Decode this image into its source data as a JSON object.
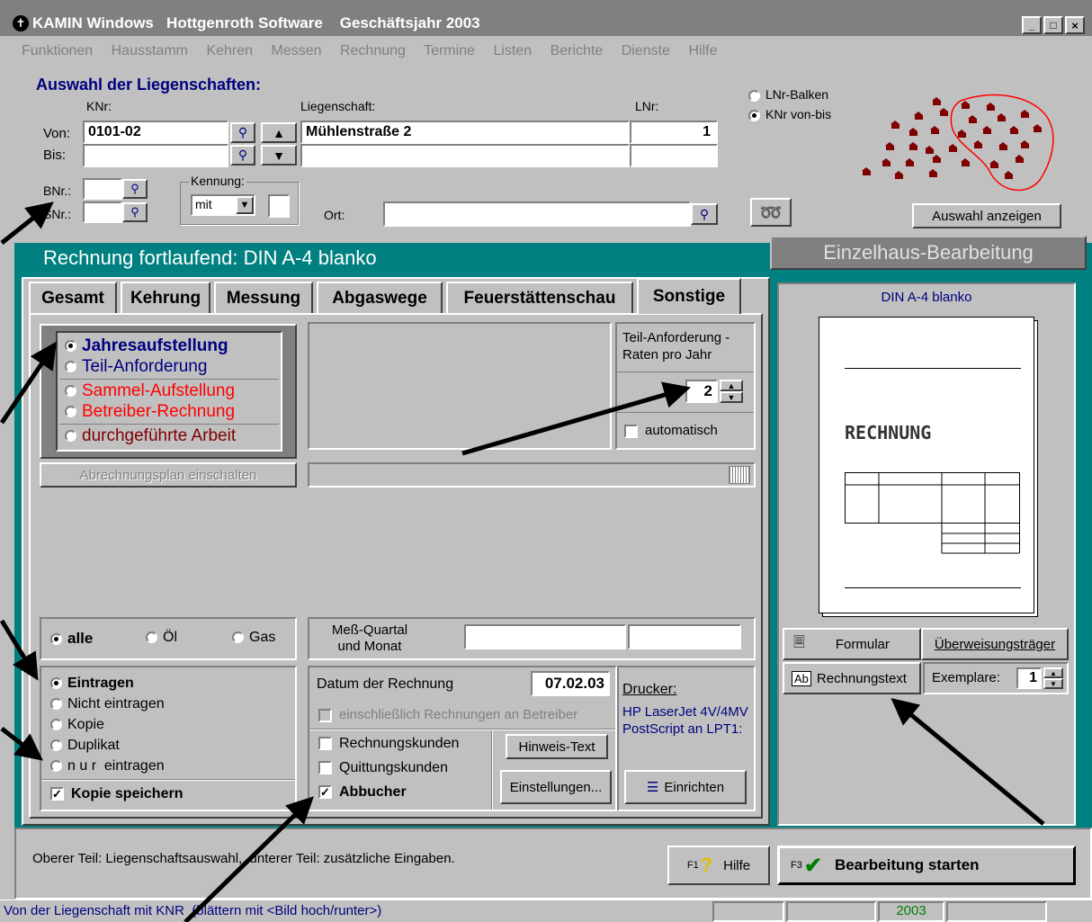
{
  "window": {
    "title": "KAMIN Windows   Hottgenroth Software    Geschäftsjahr 2003",
    "controls": [
      "_",
      "□",
      "×"
    ]
  },
  "menu": [
    "Funktionen",
    "Hausstamm",
    "Kehren",
    "Messen",
    "Rechnung",
    "Termine",
    "Listen",
    "Berichte",
    "Dienste",
    "Hilfe"
  ],
  "selection": {
    "heading": "Auswahl der Liegenschaften:",
    "col_knr": "KNr:",
    "col_liegenschaft": "Liegenschaft:",
    "col_lnr": "LNr:",
    "von_label": "Von:",
    "bis_label": "Bis:",
    "von_knr": "0101-02",
    "von_liegenschaft": "Mühlenstraße 2",
    "von_lnr": "1",
    "bis_knr": "",
    "bnr_label": "BNr.:",
    "snr_label": "SNr.:",
    "kennung_label": "Kennung:",
    "kennung_value": "mit",
    "ort_label": "Ort:",
    "ort_value": "",
    "radio_lnr_balken": "LNr-Balken",
    "radio_knr_vonbis": "KNr von-bis",
    "auswahl_button": "Auswahl anzeigen"
  },
  "panel": {
    "header": "Rechnung fortlaufend: DIN A-4 blanko",
    "right_header": "Einzelhaus-Bearbeitung",
    "tabs": [
      "Gesamt",
      "Kehrung",
      "Messung",
      "Abgaswege",
      "Feuerstättenschau",
      "Sonstige"
    ]
  },
  "invoice_type": {
    "options": [
      "Jahresaufstellung",
      "Teil-Anforderung",
      "Sammel-Aufstellung",
      "Betreiber-Rechnung",
      "durchgeführte Arbeit"
    ],
    "selected": "Jahresaufstellung",
    "plan_button": "Abrechnungsplan einschalten"
  },
  "teil": {
    "label": "Teil-Anforderung - Raten pro Jahr",
    "rates": "2",
    "auto_label": "automatisch"
  },
  "fuel": {
    "options": [
      "alle",
      "Öl",
      "Gas"
    ],
    "selected": "alle"
  },
  "mess": {
    "label": "Meß-Quartal und Monat"
  },
  "entry": {
    "options": [
      "Eintragen",
      "Nicht eintragen",
      "Kopie",
      "Duplikat",
      "n u r  eintragen"
    ],
    "selected": "Eintragen",
    "save_copy": "Kopie speichern"
  },
  "datum": {
    "label": "Datum der Rechnung",
    "value": "07.02.03",
    "incl_label": "einschließlich Rechnungen an Betreiber",
    "rechnungskunden": "Rechnungskunden",
    "quittungskunden": "Quittungskunden",
    "abbucher": "Abbucher",
    "hinweis_button": "Hinweis-Text",
    "einstellungen_button": "Einstellungen..."
  },
  "drucker": {
    "label": "Drucker:",
    "name": "HP LaserJet 4V/4MV PostScript an LPT1:",
    "einrichten_button": "Einrichten"
  },
  "preview": {
    "title": "DIN A-4 blanko",
    "doc_title": "RECHNUNG",
    "formular_button": "Formular",
    "ueberweisung_button": "Überweisungsträger",
    "rechnungstext_button": "Rechnungstext",
    "exemplare_label": "Exemplare:",
    "exemplare_value": "1"
  },
  "bottom": {
    "hint": "Oberer Teil: Liegenschaftsauswahl,  unterer Teil: zusätzliche Eingaben.",
    "help_key": "F1",
    "help_label": "Hilfe",
    "start_key": "F3",
    "start_label": "Bearbeitung starten"
  },
  "status": {
    "text": "Von der Liegenschaft mit KNR  (blättern mit <Bild hoch/runter>)",
    "year": "2003"
  },
  "colors": {
    "title_bar": "#808080",
    "teal": "#008080",
    "navy": "#000080",
    "red": "#ff0000",
    "maroon": "#800000"
  }
}
